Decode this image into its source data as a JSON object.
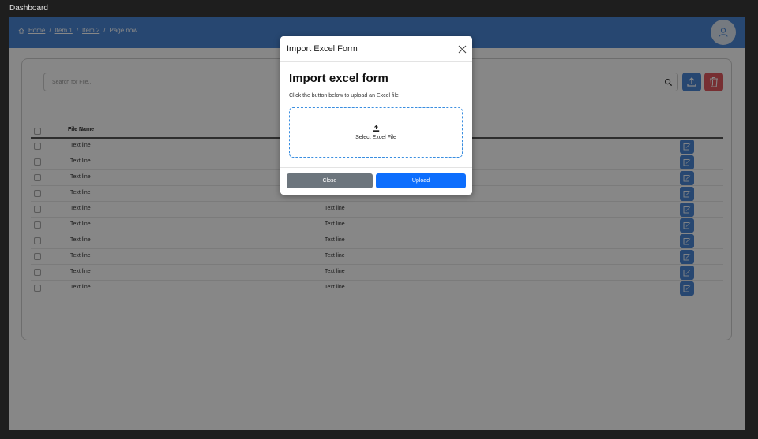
{
  "window": {
    "title": "Dashboard"
  },
  "header": {
    "breadcrumb": {
      "home": "Home",
      "item1": "Item 1",
      "item2": "Item 2",
      "current": "Page now",
      "separator": "/"
    }
  },
  "search": {
    "placeholder": "Search for File..."
  },
  "table": {
    "columns": {
      "name": "File Name"
    },
    "rows": [
      {
        "name": "Text line",
        "col2": ""
      },
      {
        "name": "Text line",
        "col2": ""
      },
      {
        "name": "Text line",
        "col2": ""
      },
      {
        "name": "Text line",
        "col2": ""
      },
      {
        "name": "Text line",
        "col2": "Text line"
      },
      {
        "name": "Text line",
        "col2": "Text line"
      },
      {
        "name": "Text line",
        "col2": "Text line"
      },
      {
        "name": "Text line",
        "col2": "Text line"
      },
      {
        "name": "Text line",
        "col2": "Text line"
      },
      {
        "name": "Text line",
        "col2": "Text line"
      }
    ]
  },
  "modal": {
    "title": "Import Excel Form",
    "heading": "Import excel form",
    "description": "Click the button below to upload an Excel file",
    "dropzone_label": "Select Excel File",
    "close_label": "Close",
    "upload_label": "Upload"
  },
  "colors": {
    "header": "#4a86d6",
    "primary": "#0d6efd",
    "secondary": "#6c757d",
    "danger": "#e05a5f"
  }
}
